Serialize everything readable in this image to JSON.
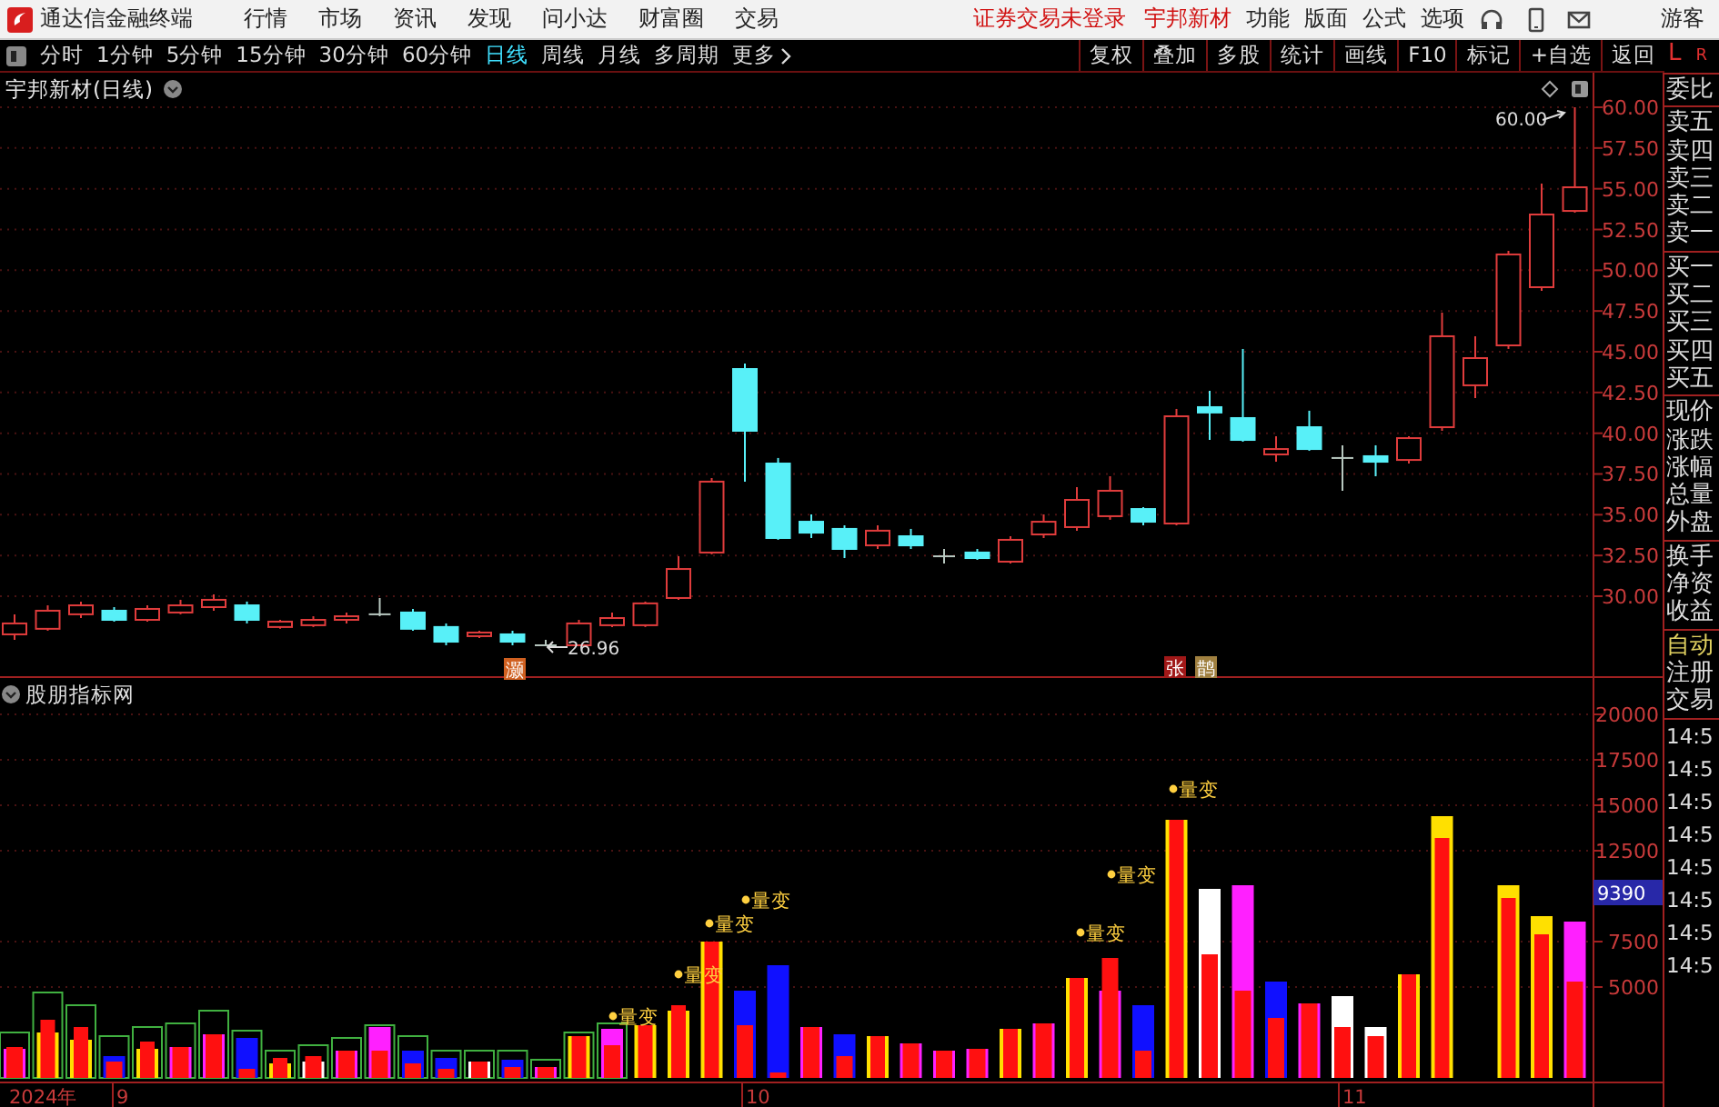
{
  "app": {
    "name": "通达信金融终端"
  },
  "menu": [
    "行情",
    "市场",
    "资讯",
    "发现",
    "问小达",
    "财富圈",
    "交易"
  ],
  "login_status": "证券交易未登录",
  "stock_name": "宇邦新材",
  "top_right": [
    "功能",
    "版面",
    "公式",
    "选项"
  ],
  "user": "游客",
  "periods": [
    {
      "label": "分时",
      "selected": false
    },
    {
      "label": "1分钟",
      "selected": false
    },
    {
      "label": "5分钟",
      "selected": false
    },
    {
      "label": "15分钟",
      "selected": false
    },
    {
      "label": "30分钟",
      "selected": false
    },
    {
      "label": "60分钟",
      "selected": false
    },
    {
      "label": "日线",
      "selected": true
    },
    {
      "label": "周线",
      "selected": false
    },
    {
      "label": "月线",
      "selected": false
    },
    {
      "label": "多周期",
      "selected": false
    }
  ],
  "more": "更多",
  "actions": [
    "复权",
    "叠加",
    "多股",
    "统计",
    "画线",
    "F10",
    "标记",
    "+自选",
    "返回"
  ],
  "chart": {
    "title": "宇邦新材(日线)",
    "chart_data": {
      "type": "candlestick",
      "ylim": [
        -1.34,
        62.12
      ],
      "yticks": [
        {
          "value": 60,
          "label": "60.00"
        },
        {
          "value": 57.5,
          "label": "57.50"
        },
        {
          "value": 55,
          "label": "55.00"
        },
        {
          "value": 52.5,
          "label": "52.50"
        },
        {
          "value": 50,
          "label": "50.00"
        },
        {
          "value": 47.5,
          "label": "47.50"
        },
        {
          "value": 45,
          "label": "45.00"
        },
        {
          "value": 42.5,
          "label": "42.50"
        },
        {
          "value": 40,
          "label": "40.00"
        },
        {
          "value": 37.5,
          "label": "37.50"
        },
        {
          "value": 35,
          "label": "35.00"
        },
        {
          "value": 32.5,
          "label": "32.50"
        },
        {
          "value": 30,
          "label": "30.00"
        }
      ],
      "ohlc": [
        [
          27.66,
          28.89,
          27.32,
          28.33
        ],
        [
          28.0,
          29.44,
          27.88,
          29.11
        ],
        [
          28.89,
          29.67,
          28.66,
          29.44
        ],
        [
          29.11,
          29.33,
          28.44,
          28.55
        ],
        [
          28.55,
          29.44,
          28.44,
          29.22
        ],
        [
          29.0,
          29.78,
          28.89,
          29.44
        ],
        [
          29.33,
          30.11,
          29.11,
          29.78
        ],
        [
          29.44,
          29.67,
          28.33,
          28.55
        ],
        [
          28.11,
          28.55,
          28.0,
          28.44
        ],
        [
          28.22,
          28.77,
          28.11,
          28.55
        ],
        [
          28.55,
          29.0,
          28.33,
          28.77
        ],
        [
          28.89,
          29.89,
          28.77,
          28.89
        ],
        [
          29.0,
          29.22,
          27.88,
          28.0
        ],
        [
          28.11,
          28.33,
          26.99,
          27.21
        ],
        [
          27.55,
          27.88,
          27.44,
          27.77
        ],
        [
          27.66,
          27.88,
          26.99,
          27.21
        ],
        [
          26.99,
          27.32,
          26.96,
          26.99
        ],
        [
          26.99,
          28.55,
          26.99,
          28.33
        ],
        [
          28.22,
          29.0,
          28.11,
          28.66
        ],
        [
          28.22,
          29.67,
          28.11,
          29.56
        ],
        [
          29.89,
          32.45,
          29.78,
          31.67
        ],
        [
          32.68,
          37.25,
          32.57,
          37.03
        ],
        [
          43.94,
          44.28,
          37.03,
          40.15
        ],
        [
          38.14,
          38.48,
          33.46,
          33.57
        ],
        [
          34.57,
          35.02,
          33.57,
          33.9
        ],
        [
          34.13,
          34.35,
          32.34,
          32.9
        ],
        [
          33.12,
          34.35,
          32.9,
          34.02
        ],
        [
          33.68,
          34.13,
          32.9,
          33.12
        ],
        [
          32.45,
          32.9,
          32.01,
          32.45
        ],
        [
          32.68,
          32.9,
          32.23,
          32.34
        ],
        [
          32.12,
          33.68,
          32.01,
          33.46
        ],
        [
          33.79,
          35.02,
          33.57,
          34.57
        ],
        [
          34.24,
          36.69,
          34.02,
          35.91
        ],
        [
          34.91,
          37.36,
          34.69,
          36.47
        ],
        [
          35.35,
          35.46,
          34.35,
          34.57
        ],
        [
          34.46,
          41.49,
          34.35,
          41.04
        ],
        [
          41.6,
          42.6,
          39.59,
          41.27
        ],
        [
          40.93,
          45.17,
          39.48,
          39.59
        ],
        [
          38.7,
          39.81,
          38.25,
          39.03
        ],
        [
          40.37,
          41.38,
          38.92,
          39.03
        ],
        [
          38.48,
          39.26,
          36.47,
          38.48
        ],
        [
          38.59,
          39.26,
          37.36,
          38.25
        ],
        [
          38.36,
          39.81,
          38.14,
          39.7
        ],
        [
          40.37,
          47.4,
          40.15,
          45.95
        ],
        [
          42.94,
          45.95,
          42.16,
          44.61
        ],
        [
          45.39,
          51.19,
          45.17,
          50.97
        ],
        [
          48.96,
          55.32,
          48.74,
          53.42
        ],
        [
          53.64,
          60.0,
          53.53,
          55.09
        ]
      ]
    },
    "high_label": "60.00",
    "low_label": "26.96",
    "signals": [
      {
        "text": "灏",
        "color": "#d06020"
      },
      {
        "text": "张",
        "color": "#a01818"
      },
      {
        "text": "鹊",
        "color": "#a08040"
      }
    ],
    "indicator_title": "股朋指标网",
    "volume_ticks": [
      "20000",
      "17500",
      "15000",
      "12500",
      "7500",
      "5000"
    ],
    "current_volume": "9390",
    "volume_marks": [
      "量变",
      "量变",
      "量变",
      "量变",
      "量变",
      "量变",
      "量变"
    ],
    "dates": [
      "2024年",
      "9",
      "10",
      "11"
    ]
  },
  "side": {
    "left": "L",
    "right": "R",
    "groups": [
      {
        "items": [
          {
            "label": "委比",
            "active": false
          }
        ]
      },
      {
        "items": [
          {
            "label": "卖五",
            "active": false
          },
          {
            "label": "卖四",
            "active": false
          },
          {
            "label": "卖三",
            "active": false
          },
          {
            "label": "卖二",
            "active": false
          },
          {
            "label": "卖一",
            "active": false
          }
        ]
      },
      {
        "items": [
          {
            "label": "买一",
            "active": false
          },
          {
            "label": "买二",
            "active": false
          },
          {
            "label": "买三",
            "active": false
          },
          {
            "label": "买四",
            "active": false
          },
          {
            "label": "买五",
            "active": false
          }
        ]
      },
      {
        "items": [
          {
            "label": "现价",
            "active": false
          },
          {
            "label": "涨跌",
            "active": false
          },
          {
            "label": "涨幅",
            "active": false
          },
          {
            "label": "总量",
            "active": false
          },
          {
            "label": "外盘",
            "active": false
          }
        ]
      },
      {
        "items": [
          {
            "label": "换手",
            "active": false
          },
          {
            "label": "净资",
            "active": false
          },
          {
            "label": "收益",
            "active": false
          }
        ]
      },
      {
        "items": [
          {
            "label": "自动",
            "active": true
          },
          {
            "label": "注册",
            "active": false
          },
          {
            "label": "交易",
            "active": false
          }
        ]
      }
    ],
    "times": [
      "14:5",
      "14:5",
      "14:5",
      "14:5",
      "14:5",
      "14:5",
      "14:5",
      "14:5"
    ]
  }
}
